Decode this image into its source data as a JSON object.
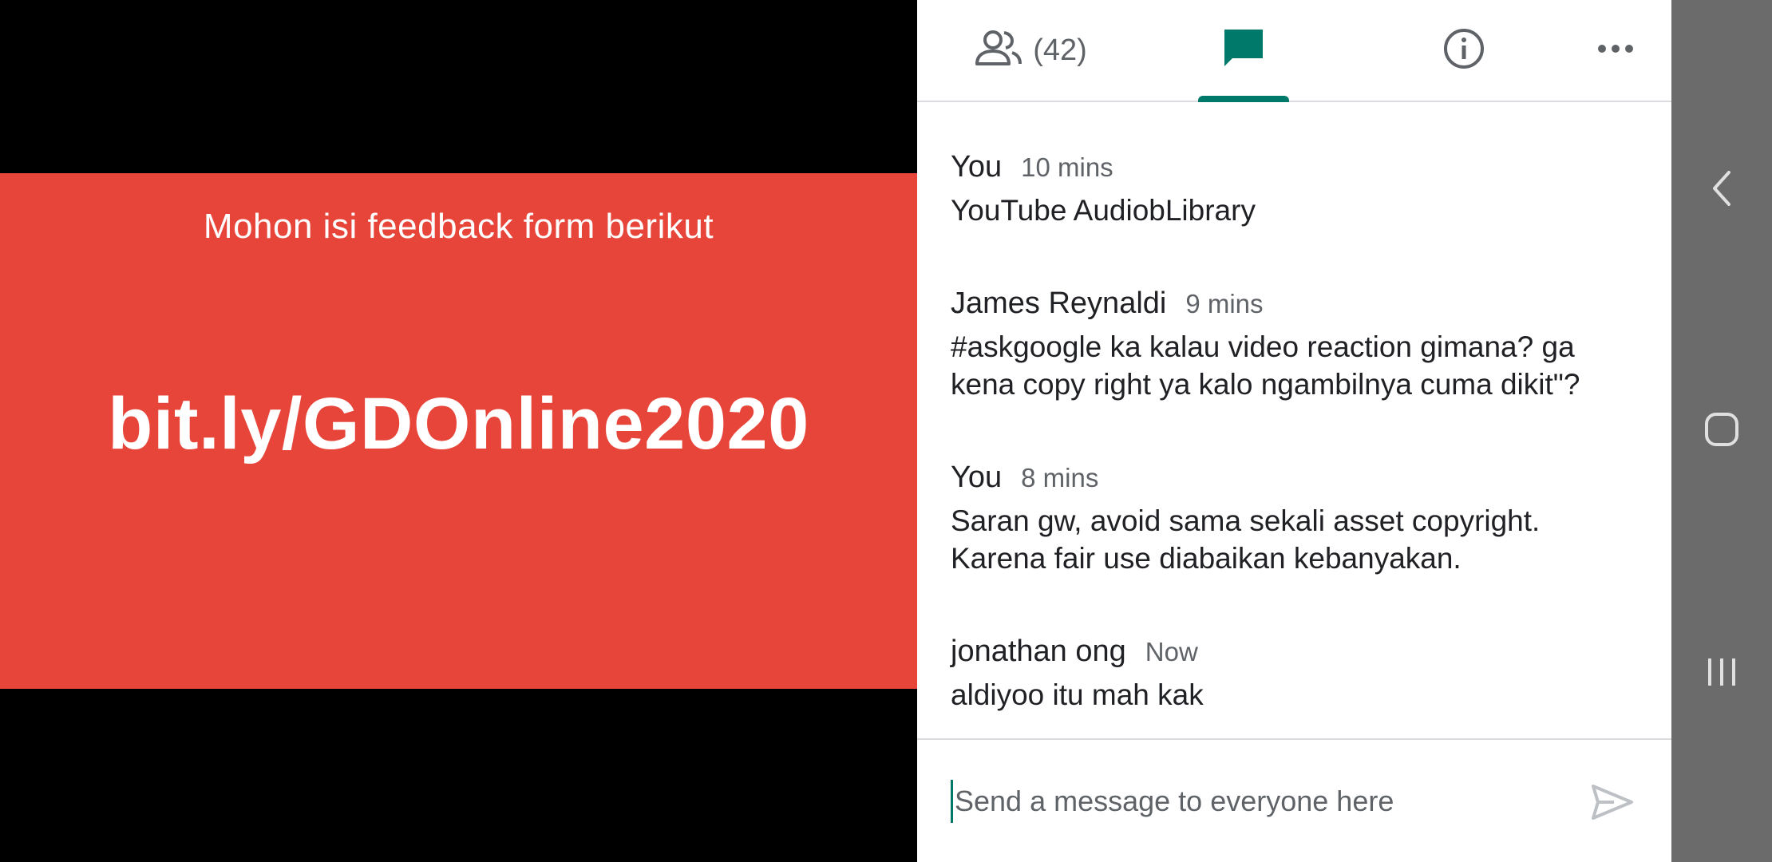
{
  "slide": {
    "subtitle": "Mohon isi feedback form berikut",
    "link": "bit.ly/GDOnline2020",
    "background_color": "#e8453a"
  },
  "tabs": {
    "people": {
      "icon": "people-icon",
      "count": "(42)"
    },
    "chat": {
      "icon": "chat-icon",
      "active": true,
      "accent_color": "#00796b"
    },
    "info": {
      "icon": "info-icon"
    },
    "more": {
      "icon": "more-horizontal-icon"
    }
  },
  "messages": [
    {
      "sender": "You",
      "time": "10 mins",
      "lines": [
        "YouTube AudiobLibrary"
      ]
    },
    {
      "sender": "James Reynaldi",
      "time": "9 mins",
      "lines": [
        "#askgoogle ka kalau video reaction gimana? ga",
        "kena copy right ya kalo ngambilnya cuma dikit\"?"
      ]
    },
    {
      "sender": "You",
      "time": "8 mins",
      "lines": [
        "Saran gw, avoid sama sekali asset copyright.",
        "Karena fair use diabaikan kebanyakan."
      ]
    },
    {
      "sender": "jonathan ong",
      "time": "Now",
      "lines": [
        "aldiyoo itu mah kak"
      ]
    }
  ],
  "composer": {
    "placeholder": "Send a message to everyone here",
    "send_icon": "send-icon"
  },
  "navbar": {
    "back_icon": "back-icon",
    "home_icon": "home-icon",
    "recents_icon": "recents-icon"
  }
}
